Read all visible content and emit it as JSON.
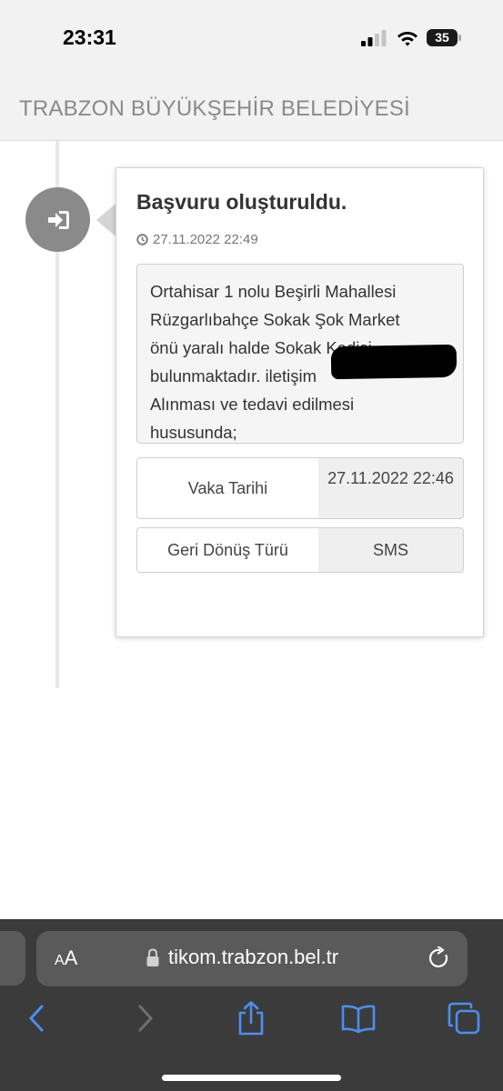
{
  "status_bar": {
    "time": "23:31",
    "battery_level": "35",
    "icons": [
      "signal-icon",
      "wifi-icon",
      "battery-icon"
    ]
  },
  "header": {
    "title": "TRABZON BÜYÜKŞEHİR BELEDİYESİ"
  },
  "timeline": {
    "badge_icon": "sign-in-icon",
    "card": {
      "title": "Başvuru oluşturuldu.",
      "time_icon": "clock-icon",
      "timestamp": "27.11.2022 22:49",
      "description": {
        "line1": "Ortahisar 1 nolu Beşirli Mahallesi",
        "line2": "Rüzgarlıbahçe Sokak Şok Market",
        "line3": "önü yaralı halde Sokak Kedisi",
        "line4": "bulunmaktadır. iletişim",
        "line5": "Alınması ve tedavi edilmesi",
        "line6": "hususunda;"
      },
      "fields": [
        {
          "label": "Vaka Tarihi",
          "value": "27.11.2022 22:46"
        },
        {
          "label": "Geri Dönüş Türü",
          "value": "SMS"
        }
      ]
    }
  },
  "browser": {
    "text_size_label": "AA",
    "url": "tikom.trabzon.bel.tr",
    "icons": [
      "lock-icon",
      "reload-icon",
      "back-icon",
      "forward-icon",
      "share-icon",
      "bookmarks-icon",
      "tabs-icon"
    ],
    "colors": {
      "accent": "#4a8ff0",
      "disabled": "#6e6e6e"
    }
  }
}
